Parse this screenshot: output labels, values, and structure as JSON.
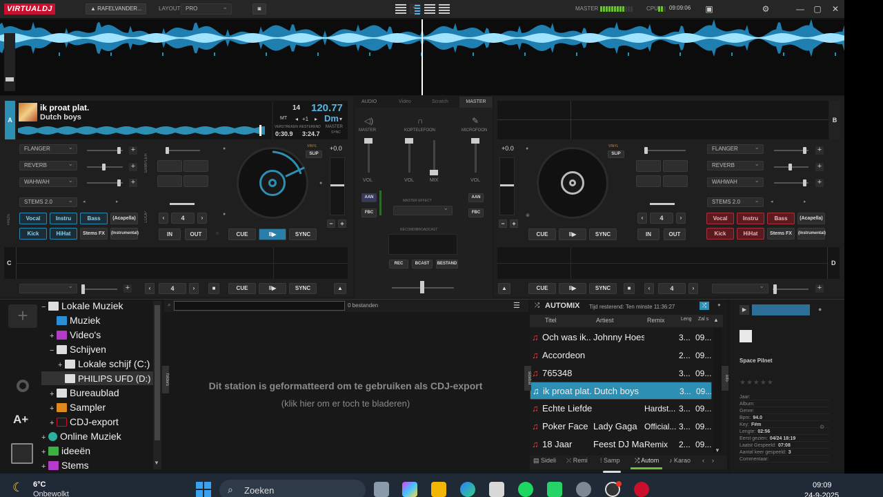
{
  "topbar": {
    "app_logo": "VIRTUALDJ",
    "user": "RAFELVANDER...",
    "layout_label": "LAYOUT",
    "layout_value": "PRO",
    "master_label": "MASTER",
    "cpu_label": "CPU",
    "clock": "09:09:06"
  },
  "deck_a": {
    "letter": "A",
    "title": "ik proat plat.",
    "artist": "Dutch boys",
    "key_num": "14",
    "bpm": "120.77",
    "mt": "MT",
    "pitch_step": "+1",
    "key": "Dm",
    "elapsed": "0:30.9",
    "remain": "3:24.7",
    "elapsed_label": "VERSTREKEN",
    "remain_label": "RESTEREND",
    "master_label": "MASTER",
    "sync_label": "SYNC",
    "fx": [
      "FLANGER",
      "REVERB",
      "WAHWAH"
    ],
    "stems_label": "STEMS 2.0",
    "stems_pads": [
      "Vocal",
      "Instru",
      "Bass",
      "(Acapella)",
      "Kick",
      "HiHat",
      "Stems FX",
      "(Instrumental)"
    ],
    "vinyl": "VINYL",
    "slip": "SLIP",
    "pitch_value": "+0.0",
    "loop_value": "4",
    "in_label": "IN",
    "out_label": "OUT",
    "cue": "CUE",
    "play": "II▶",
    "sync": "SYNC",
    "sampler_label": "SAMPLER",
    "loop_label": "LOOP",
    "pads_label": "PADS"
  },
  "deck_b": {
    "letter": "B",
    "fx": [
      "FLANGER",
      "REVERB",
      "WAHWAH"
    ],
    "stems_label": "STEMS 2.0",
    "stems_pads": [
      "Vocal",
      "Instru",
      "Bass",
      "(Acapella)",
      "Kick",
      "HiHat",
      "Stems FX",
      "(Instrumental)"
    ],
    "vinyl": "VINYL",
    "slip": "SLIP",
    "pitch_value": "+0.0",
    "loop_value": "4",
    "in_label": "IN",
    "out_label": "OUT",
    "cue": "CUE",
    "play": "II▶",
    "sync": "SYNC"
  },
  "deck_c": {
    "letter": "C",
    "loop_value": "4",
    "cue": "CUE",
    "play": "II▶",
    "sync": "SYNC"
  },
  "deck_d": {
    "letter": "D",
    "loop_value": "4",
    "cue": "CUE",
    "play": "II▶",
    "sync": "SYNC"
  },
  "mixer": {
    "tabs": [
      "AUDIO",
      "Video",
      "Scratch",
      "MASTER"
    ],
    "master_label": "MASTER",
    "headphones_label": "KOPTELEFOON",
    "mic_label": "MICROFOON",
    "vol": "VOL",
    "mix": "MIX",
    "aan": "AAN",
    "fbc": "FBC",
    "master_effect": "MASTER EFFECT",
    "record_broadcast": "RECORD/BROADCAST",
    "rec": "REC",
    "bcast": "BCAST",
    "bestand": "BESTAND"
  },
  "browser": {
    "add_icon": "plus-icon",
    "tree": [
      {
        "label": "Lokale Muziek",
        "toggle": "−"
      },
      {
        "label": "Muziek",
        "toggle": ""
      },
      {
        "label": "Video's",
        "toggle": "+"
      },
      {
        "label": "Schijven",
        "toggle": "−"
      },
      {
        "label": "Lokale schijf (C:)",
        "toggle": "+"
      },
      {
        "label": "PHILIPS UFD (D:)",
        "toggle": ""
      },
      {
        "label": "Bureaublad",
        "toggle": "+"
      },
      {
        "label": "Sampler",
        "toggle": "+"
      },
      {
        "label": "CDJ-export",
        "toggle": "+"
      },
      {
        "label": "Online Muziek",
        "toggle": "+"
      },
      {
        "label": "ideeën",
        "toggle": "+"
      },
      {
        "label": "Stems",
        "toggle": "+"
      }
    ],
    "file_count": "0 bestanden",
    "folders_tab": "folders",
    "message": "Dit station is geformatteerd om te gebruiken als CDJ-export",
    "message_sub": "(klik hier om er toch te bladeren)"
  },
  "automix": {
    "title": "AUTOMIX",
    "remaining": "Tijd resterend: Ten minste 11:36:27",
    "sidebar_tab": "sidebar",
    "info_tab": "info",
    "columns": [
      "Titel",
      "Artiest",
      "Remix",
      "Leng",
      "Zal s"
    ],
    "rows": [
      {
        "title": "Och was ik...",
        "artist": "Johnny Hoes",
        "remix": "",
        "len": "3...",
        "date": "09..."
      },
      {
        "title": "Accordeon",
        "artist": "",
        "remix": "",
        "len": "2...",
        "date": "09..."
      },
      {
        "title": "765348",
        "artist": "",
        "remix": "",
        "len": "3...",
        "date": "09..."
      },
      {
        "title": "ik proat plat.",
        "artist": "Dutch boys",
        "remix": "",
        "len": "3...",
        "date": "09..."
      },
      {
        "title": "Echte Liefde...",
        "artist": "",
        "remix": "Hardst...",
        "len": "3...",
        "date": "09..."
      },
      {
        "title": "Poker Face",
        "artist": "Lady Gaga",
        "remix": "Official...",
        "len": "3...",
        "date": "09..."
      },
      {
        "title": "18 Jaar",
        "artist": "Feest DJ Ma...",
        "remix": "Remix",
        "len": "2...",
        "date": "09..."
      }
    ],
    "bottom_tabs": [
      "Sideli",
      "Remi",
      "Samp",
      "Autom",
      "Karao"
    ]
  },
  "info": {
    "name": "Space Pilnet",
    "fields": [
      {
        "label": "Jaar:",
        "value": ""
      },
      {
        "label": "Album:",
        "value": ""
      },
      {
        "label": "Genre:",
        "value": ""
      },
      {
        "label": "Bpm:",
        "value": "94.0"
      },
      {
        "label": "Key:",
        "value": "F#m"
      },
      {
        "label": "Lengte:",
        "value": "02:56"
      },
      {
        "label": "Eerst gezien:",
        "value": "04/24 18:19"
      },
      {
        "label": "Laatst Gespeeld:",
        "value": "07:08"
      },
      {
        "label": "Aantal keer gespeeld:",
        "value": "3"
      },
      {
        "label": "Commentaar:",
        "value": ""
      }
    ]
  },
  "taskbar": {
    "temp": "6°C",
    "weather": "Onbewolkt",
    "search": "Zoeken",
    "time": "09:09",
    "date": "24-9-2025"
  }
}
